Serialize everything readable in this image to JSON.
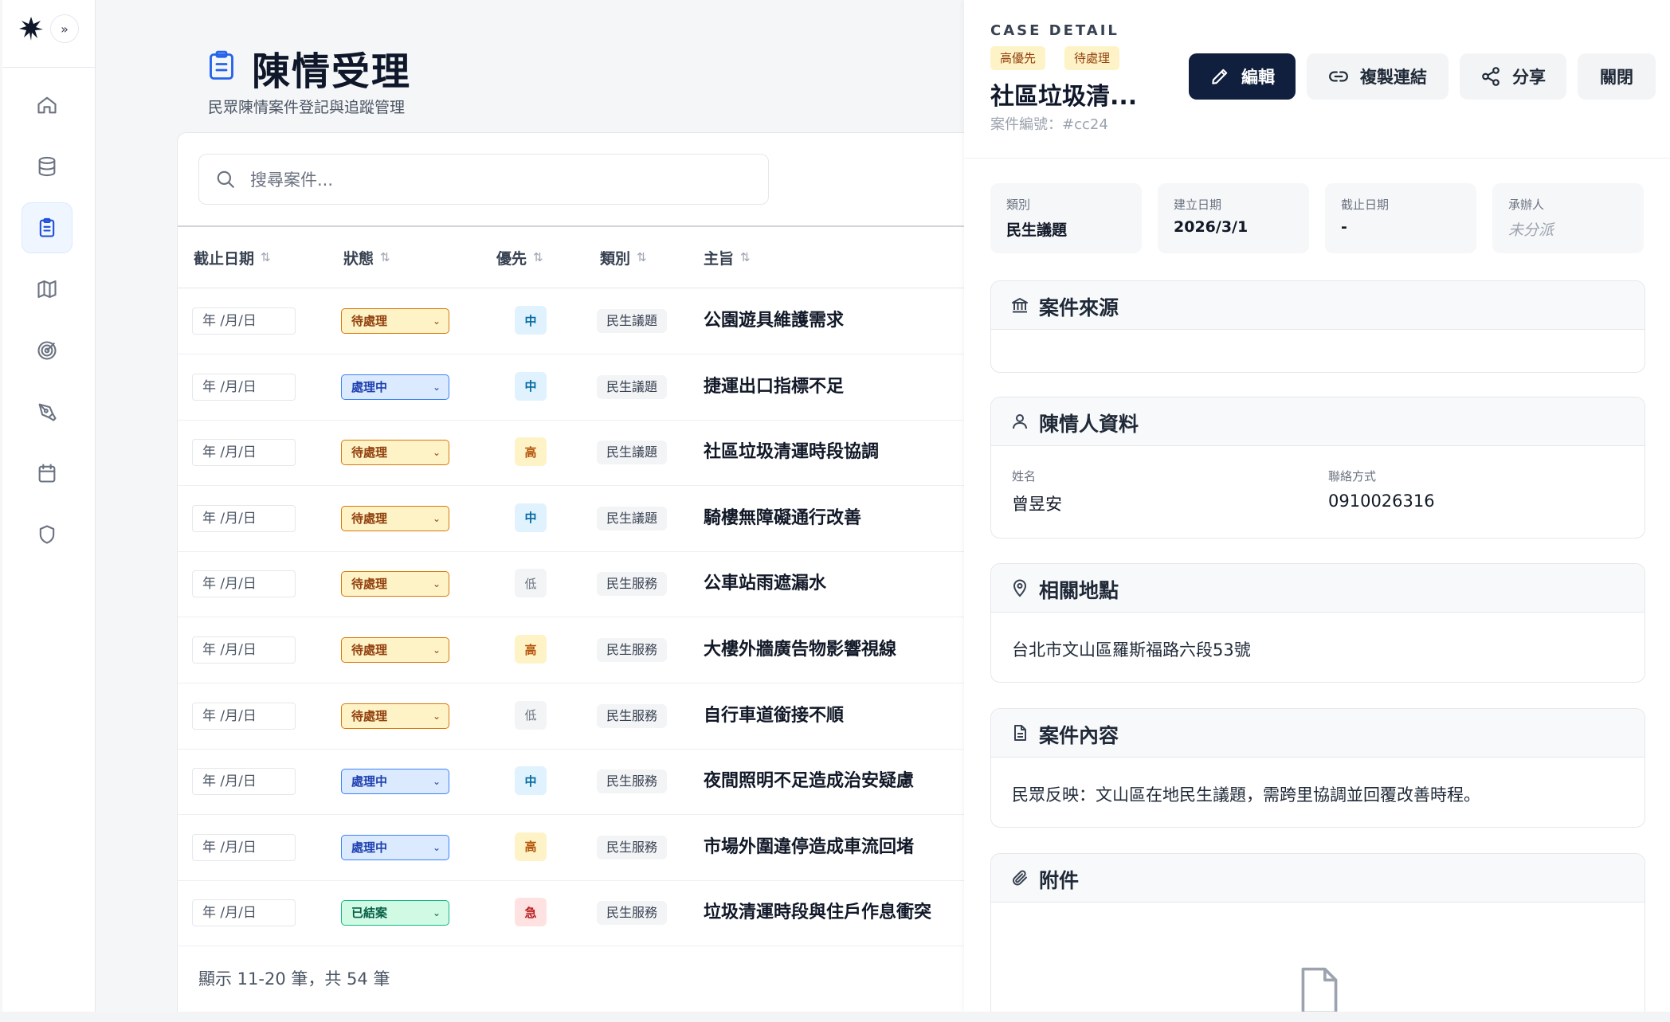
{
  "sidebar": {
    "expand_label": "»",
    "nav": [
      {
        "name": "home-icon",
        "active": false
      },
      {
        "name": "database-icon",
        "active": false
      },
      {
        "name": "clipboard-icon",
        "active": true
      },
      {
        "name": "map-icon",
        "active": false
      },
      {
        "name": "target-icon",
        "active": false
      },
      {
        "name": "pen-tool-icon",
        "active": false
      },
      {
        "name": "calendar-icon",
        "active": false
      },
      {
        "name": "shield-icon",
        "active": false
      }
    ]
  },
  "page": {
    "title": "陳情受理",
    "subtitle": "民眾陳情案件登記與追蹤管理"
  },
  "search": {
    "placeholder": "搜尋案件..."
  },
  "table": {
    "columns": [
      "截止日期",
      "狀態",
      "優先",
      "類別",
      "主旨"
    ],
    "sort_glyph": "⇅",
    "date_placeholder": "年 /月/日",
    "rows": [
      {
        "status": "待處理",
        "status_kind": "pending",
        "priority": "中",
        "priority_kind": "mid",
        "category": "民生議題",
        "subject": "公園遊具維護需求"
      },
      {
        "status": "處理中",
        "status_kind": "progress",
        "priority": "中",
        "priority_kind": "mid",
        "category": "民生議題",
        "subject": "捷運出口指標不足"
      },
      {
        "status": "待處理",
        "status_kind": "pending",
        "priority": "高",
        "priority_kind": "high",
        "category": "民生議題",
        "subject": "社區垃圾清運時段協調"
      },
      {
        "status": "待處理",
        "status_kind": "pending",
        "priority": "中",
        "priority_kind": "mid",
        "category": "民生議題",
        "subject": "騎樓無障礙通行改善"
      },
      {
        "status": "待處理",
        "status_kind": "pending",
        "priority": "低",
        "priority_kind": "low",
        "category": "民生服務",
        "subject": "公車站雨遮漏水"
      },
      {
        "status": "待處理",
        "status_kind": "pending",
        "priority": "高",
        "priority_kind": "high",
        "category": "民生服務",
        "subject": "大樓外牆廣告物影響視線"
      },
      {
        "status": "待處理",
        "status_kind": "pending",
        "priority": "低",
        "priority_kind": "low",
        "category": "民生服務",
        "subject": "自行車道銜接不順"
      },
      {
        "status": "處理中",
        "status_kind": "progress",
        "priority": "中",
        "priority_kind": "mid",
        "category": "民生服務",
        "subject": "夜間照明不足造成治安疑慮"
      },
      {
        "status": "處理中",
        "status_kind": "progress",
        "priority": "高",
        "priority_kind": "high",
        "category": "民生服務",
        "subject": "市場外圍違停造成車流回堵"
      },
      {
        "status": "已結案",
        "status_kind": "closed",
        "priority": "急",
        "priority_kind": "urgent",
        "category": "民生服務",
        "subject": "垃圾清運時段與住戶作息衝突"
      }
    ],
    "pager": "顯示 11-20 筆，共 54 筆"
  },
  "detail": {
    "label": "CASE DETAIL",
    "tags": [
      "高優先",
      "待處理"
    ],
    "title": "社區垃圾清...",
    "case_no": "案件編號：#cc24",
    "buttons": {
      "edit": "編輯",
      "copy_link": "複製連結",
      "share": "分享",
      "close": "關閉"
    },
    "meta": [
      {
        "label": "類別",
        "value": "民生議題"
      },
      {
        "label": "建立日期",
        "value": "2026/3/1"
      },
      {
        "label": "截止日期",
        "value": "-"
      },
      {
        "label": "承辦人",
        "value": "未分派"
      }
    ],
    "source": {
      "title": "案件來源"
    },
    "petitioner": {
      "title": "陳情人資料",
      "name_label": "姓名",
      "name": "曾昱安",
      "contact_label": "聯絡方式",
      "contact": "0910026316"
    },
    "location": {
      "title": "相關地點",
      "address": "台北市文山區羅斯福路六段53號"
    },
    "content": {
      "title": "案件內容",
      "text": "民眾反映：文山區在地民生議題，需跨里協調並回覆改善時程。"
    },
    "attachments": {
      "title": "附件"
    }
  }
}
